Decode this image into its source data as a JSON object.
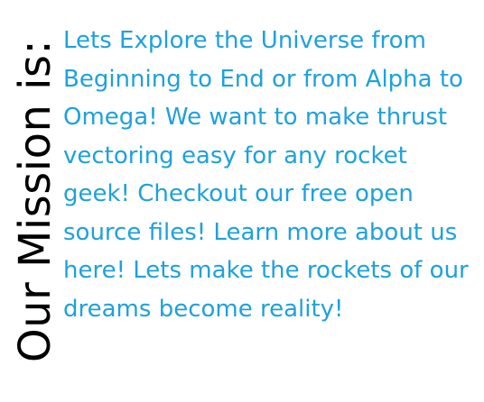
{
  "heading": {
    "text": "Our Mission is:"
  },
  "mission": {
    "text": "Lets Explore the Universe from Beginning to End or from Alpha to Omega! We want to make thrust vectoring easy for any rocket geek! Checkout our free open source files! Learn more about us here! Lets make the rockets of our dreams become reality!"
  },
  "colors": {
    "heading": "#000000",
    "body_text": "#1ea1dd",
    "background": "#ffffff"
  }
}
